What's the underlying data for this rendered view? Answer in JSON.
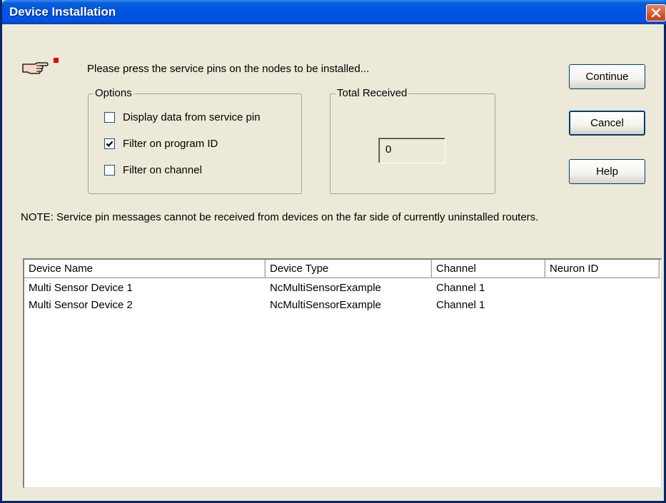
{
  "window": {
    "title": "Device Installation",
    "close_label": "close"
  },
  "instruction": "Please press the service pins on the nodes to be installed...",
  "options": {
    "label": "Options",
    "checkboxes": [
      {
        "label": "Display data from service pin",
        "checked": false
      },
      {
        "label": "Filter on program ID",
        "checked": true
      },
      {
        "label": "Filter on channel",
        "checked": false
      }
    ]
  },
  "total_received": {
    "label": "Total Received",
    "value": "0"
  },
  "buttons": {
    "continue": "Continue",
    "cancel": "Cancel",
    "help": "Help"
  },
  "note": "NOTE: Service pin messages cannot be received from devices on the far side of currently uninstalled routers.",
  "device_list": {
    "columns": [
      "Device Name",
      "Device Type",
      "Channel",
      "Neuron ID"
    ],
    "rows": [
      [
        "Multi Sensor Device 1",
        "NcMultiSensorExample",
        "Channel 1",
        ""
      ],
      [
        "Multi Sensor Device 2",
        "NcMultiSensorExample",
        "Channel 1",
        ""
      ]
    ]
  },
  "icons": {
    "hand": "pointing-hand-icon",
    "led": "service-led-icon",
    "close": "close-icon",
    "check": "check-icon"
  },
  "colors": {
    "titlebar": "#0054e3",
    "dialog_bg": "#ece9d8",
    "close_button": "#c73e14",
    "led": "#e00000"
  }
}
